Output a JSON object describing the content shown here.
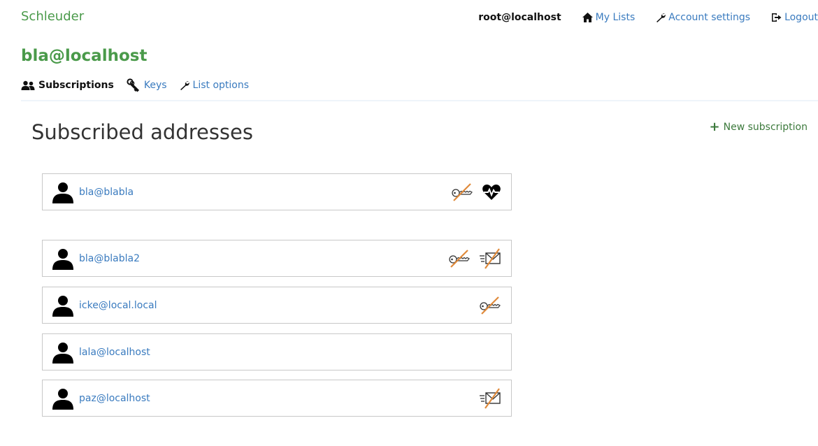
{
  "app": {
    "brand": "Schleuder"
  },
  "topnav": {
    "user": "root@localhost",
    "my_lists": "My Lists",
    "account_settings": "Account settings",
    "logout": "Logout"
  },
  "list": {
    "title": "bla@localhost"
  },
  "tabs": {
    "subscriptions": "Subscriptions",
    "keys": "Keys",
    "list_options": "List options"
  },
  "page": {
    "heading": "Subscribed addresses",
    "new_subscription": "New subscription"
  },
  "subscriptions": [
    {
      "email": "bla@blabla",
      "icons": [
        "no-key-icon",
        "admin-heart-icon"
      ]
    },
    {
      "email": "bla@blabla2",
      "icons": [
        "no-key-icon",
        "delivery-disabled-icon"
      ]
    },
    {
      "email": "icke@local.local",
      "icons": [
        "no-key-icon"
      ]
    },
    {
      "email": "lala@localhost",
      "icons": []
    },
    {
      "email": "paz@localhost",
      "icons": [
        "delivery-disabled-icon"
      ]
    }
  ],
  "colors": {
    "brand_green": "#4a9a4a",
    "link_blue": "#3a7bbf",
    "strike_orange": "#e08a3a"
  }
}
